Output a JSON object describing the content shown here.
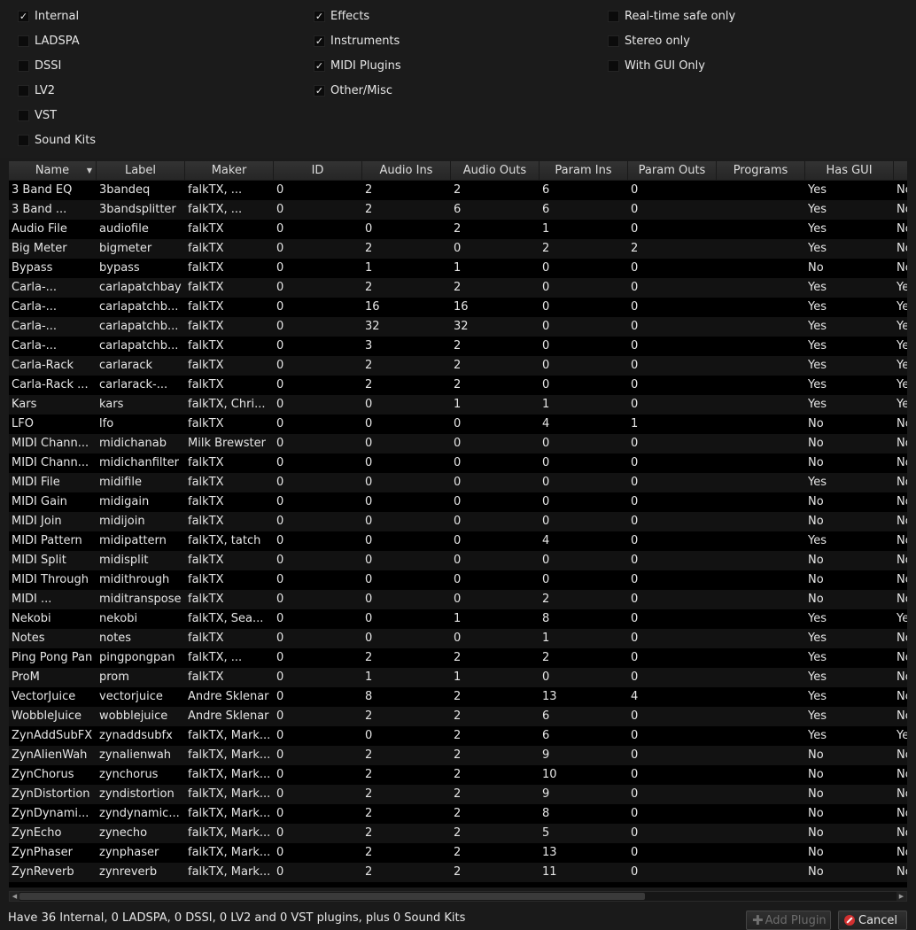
{
  "filters": {
    "col1": [
      {
        "label": "Internal",
        "checked": true
      },
      {
        "label": "LADSPA",
        "checked": false
      },
      {
        "label": "DSSI",
        "checked": false
      },
      {
        "label": "LV2",
        "checked": false
      },
      {
        "label": "VST",
        "checked": false
      },
      {
        "label": "Sound Kits",
        "checked": false
      }
    ],
    "col2": [
      {
        "label": "Effects",
        "checked": true
      },
      {
        "label": "Instruments",
        "checked": true
      },
      {
        "label": "MIDI Plugins",
        "checked": true
      },
      {
        "label": "Other/Misc",
        "checked": true
      }
    ],
    "col3": [
      {
        "label": "Real-time safe only",
        "checked": false
      },
      {
        "label": "Stereo only",
        "checked": false
      },
      {
        "label": "With GUI Only",
        "checked": false
      }
    ]
  },
  "table": {
    "columns": [
      "Name",
      "Label",
      "Maker",
      "ID",
      "Audio Ins",
      "Audio Outs",
      "Param Ins",
      "Param Outs",
      "Programs",
      "Has GUI",
      ""
    ],
    "rows": [
      [
        "3 Band EQ",
        "3bandeq",
        "falkTX, ...",
        "0",
        "2",
        "2",
        "6",
        "0",
        "",
        "Yes",
        "No"
      ],
      [
        "3 Band ...",
        "3bandsplitter",
        "falkTX, ...",
        "0",
        "2",
        "6",
        "6",
        "0",
        "",
        "Yes",
        "No"
      ],
      [
        "Audio File",
        "audiofile",
        "falkTX",
        "0",
        "0",
        "2",
        "1",
        "0",
        "",
        "Yes",
        "No"
      ],
      [
        "Big Meter",
        "bigmeter",
        "falkTX",
        "0",
        "2",
        "0",
        "2",
        "2",
        "",
        "Yes",
        "No"
      ],
      [
        "Bypass",
        "bypass",
        "falkTX",
        "0",
        "1",
        "1",
        "0",
        "0",
        "",
        "No",
        "No"
      ],
      [
        "Carla-...",
        "carlapatchbay",
        "falkTX",
        "0",
        "2",
        "2",
        "0",
        "0",
        "",
        "Yes",
        "Yes"
      ],
      [
        "Carla-...",
        "carlapatchb...",
        "falkTX",
        "0",
        "16",
        "16",
        "0",
        "0",
        "",
        "Yes",
        "Yes"
      ],
      [
        "Carla-...",
        "carlapatchb...",
        "falkTX",
        "0",
        "32",
        "32",
        "0",
        "0",
        "",
        "Yes",
        "Yes"
      ],
      [
        "Carla-...",
        "carlapatchb...",
        "falkTX",
        "0",
        "3",
        "2",
        "0",
        "0",
        "",
        "Yes",
        "Yes"
      ],
      [
        "Carla-Rack",
        "carlarack",
        "falkTX",
        "0",
        "2",
        "2",
        "0",
        "0",
        "",
        "Yes",
        "Yes"
      ],
      [
        "Carla-Rack ...",
        "carlarack-...",
        "falkTX",
        "0",
        "2",
        "2",
        "0",
        "0",
        "",
        "Yes",
        "Yes"
      ],
      [
        "Kars",
        "kars",
        "falkTX, Chri...",
        "0",
        "0",
        "1",
        "1",
        "0",
        "",
        "Yes",
        "Yes"
      ],
      [
        "LFO",
        "lfo",
        "falkTX",
        "0",
        "0",
        "0",
        "4",
        "1",
        "",
        "No",
        "No"
      ],
      [
        "MIDI Chann...",
        "midichanab",
        "Milk Brewster",
        "0",
        "0",
        "0",
        "0",
        "0",
        "",
        "No",
        "No"
      ],
      [
        "MIDI Chann...",
        "midichanfilter",
        "falkTX",
        "0",
        "0",
        "0",
        "0",
        "0",
        "",
        "No",
        "No"
      ],
      [
        "MIDI File",
        "midifile",
        "falkTX",
        "0",
        "0",
        "0",
        "0",
        "0",
        "",
        "Yes",
        "No"
      ],
      [
        "MIDI Gain",
        "midigain",
        "falkTX",
        "0",
        "0",
        "0",
        "0",
        "0",
        "",
        "No",
        "No"
      ],
      [
        "MIDI Join",
        "midijoin",
        "falkTX",
        "0",
        "0",
        "0",
        "0",
        "0",
        "",
        "No",
        "No"
      ],
      [
        "MIDI Pattern",
        "midipattern",
        "falkTX, tatch",
        "0",
        "0",
        "0",
        "4",
        "0",
        "",
        "Yes",
        "No"
      ],
      [
        "MIDI Split",
        "midisplit",
        "falkTX",
        "0",
        "0",
        "0",
        "0",
        "0",
        "",
        "No",
        "No"
      ],
      [
        "MIDI Through",
        "midithrough",
        "falkTX",
        "0",
        "0",
        "0",
        "0",
        "0",
        "",
        "No",
        "No"
      ],
      [
        "MIDI ...",
        "miditranspose",
        "falkTX",
        "0",
        "0",
        "0",
        "2",
        "0",
        "",
        "No",
        "No"
      ],
      [
        "Nekobi",
        "nekobi",
        "falkTX, Sea...",
        "0",
        "0",
        "1",
        "8",
        "0",
        "",
        "Yes",
        "Yes"
      ],
      [
        "Notes",
        "notes",
        "falkTX",
        "0",
        "0",
        "0",
        "1",
        "0",
        "",
        "Yes",
        "No"
      ],
      [
        "Ping Pong Pan",
        "pingpongpan",
        "falkTX, ...",
        "0",
        "2",
        "2",
        "2",
        "0",
        "",
        "Yes",
        "No"
      ],
      [
        "ProM",
        "prom",
        "falkTX",
        "0",
        "1",
        "1",
        "0",
        "0",
        "",
        "Yes",
        "No"
      ],
      [
        "VectorJuice",
        "vectorjuice",
        "Andre Sklenar",
        "0",
        "8",
        "2",
        "13",
        "4",
        "",
        "Yes",
        "No"
      ],
      [
        "WobbleJuice",
        "wobblejuice",
        "Andre Sklenar",
        "0",
        "2",
        "2",
        "6",
        "0",
        "",
        "Yes",
        "No"
      ],
      [
        "ZynAddSubFX",
        "zynaddsubfx",
        "falkTX, Mark...",
        "0",
        "0",
        "2",
        "6",
        "0",
        "",
        "Yes",
        "Yes"
      ],
      [
        "ZynAlienWah",
        "zynalienwah",
        "falkTX, Mark...",
        "0",
        "2",
        "2",
        "9",
        "0",
        "",
        "No",
        "No"
      ],
      [
        "ZynChorus",
        "zynchorus",
        "falkTX, Mark...",
        "0",
        "2",
        "2",
        "10",
        "0",
        "",
        "No",
        "No"
      ],
      [
        "ZynDistortion",
        "zyndistortion",
        "falkTX, Mark...",
        "0",
        "2",
        "2",
        "9",
        "0",
        "",
        "No",
        "No"
      ],
      [
        "ZynDynami...",
        "zyndynamic...",
        "falkTX, Mark...",
        "0",
        "2",
        "2",
        "8",
        "0",
        "",
        "No",
        "No"
      ],
      [
        "ZynEcho",
        "zynecho",
        "falkTX, Mark...",
        "0",
        "2",
        "2",
        "5",
        "0",
        "",
        "No",
        "No"
      ],
      [
        "ZynPhaser",
        "zynphaser",
        "falkTX, Mark...",
        "0",
        "2",
        "2",
        "13",
        "0",
        "",
        "No",
        "No"
      ],
      [
        "ZynReverb",
        "zynreverb",
        "falkTX, Mark...",
        "0",
        "2",
        "2",
        "11",
        "0",
        "",
        "No",
        "No"
      ]
    ]
  },
  "footer": {
    "status": "Have 36 Internal, 0 LADSPA, 0 DSSI, 0 LV2 and 0 VST plugins, plus 0 Sound Kits",
    "add_label": "Add Plugin",
    "cancel_label": "Cancel"
  },
  "icons": {
    "check": "✓",
    "sort": "▼",
    "scroll_left": "◀",
    "scroll_right": "▶",
    "plus": "✚"
  }
}
